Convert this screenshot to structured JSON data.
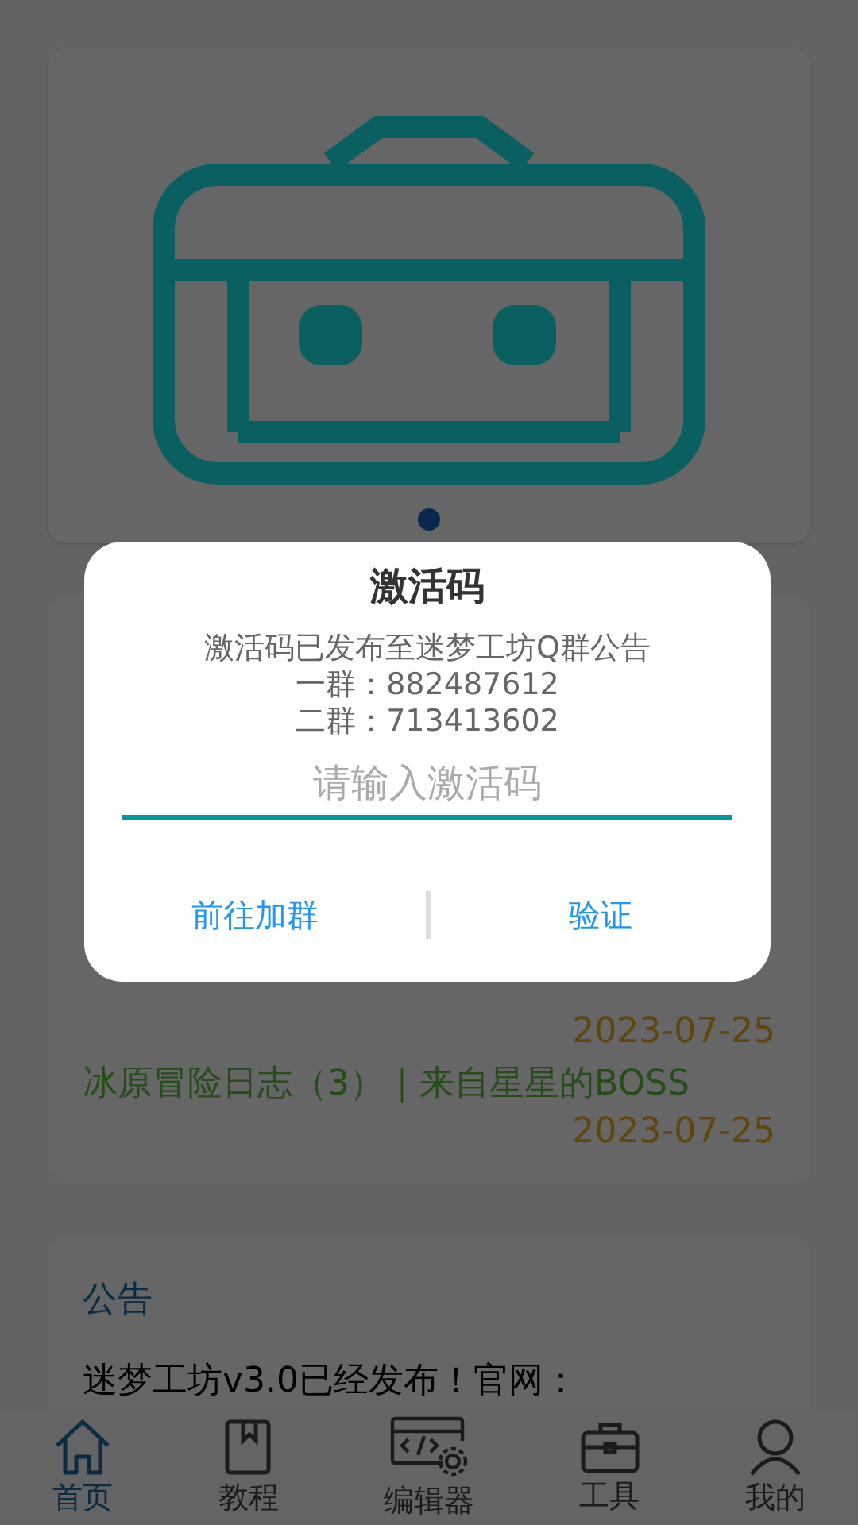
{
  "banner": {
    "dots": [
      {
        "selected": true
      }
    ]
  },
  "news": {
    "items": [
      {
        "date": "2023-07-25"
      },
      {
        "title": "冰原冒险日志（3）｜来自星星的BOSS",
        "date": "2023-07-25"
      }
    ]
  },
  "announcement": {
    "title": "公告",
    "text": "迷梦工坊v3.0已经发布！官网："
  },
  "bottom_nav": [
    {
      "label": "首页",
      "selected": true
    },
    {
      "label": "教程",
      "selected": false
    },
    {
      "label": "编辑器",
      "selected": false
    },
    {
      "label": "工具",
      "selected": false
    },
    {
      "label": "我的",
      "selected": false
    }
  ],
  "dialog": {
    "title": "激活码",
    "message": [
      "激活码已发布至迷梦工坊Q群公告",
      "一群：882487612",
      "二群：713413602"
    ],
    "input": {
      "placeholder": "请输入激活码"
    },
    "buttons": [
      "前往加群",
      "验证"
    ]
  }
}
